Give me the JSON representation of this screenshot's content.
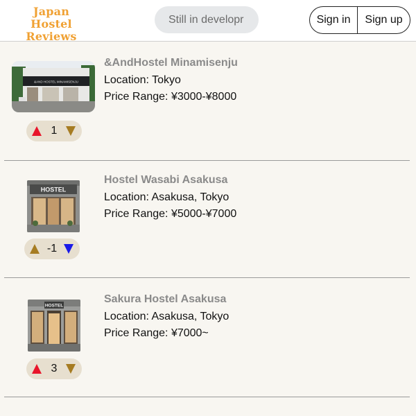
{
  "header": {
    "logo_line1": "Japan",
    "logo_line2": "Hostel Reviews",
    "search_placeholder": "Still in developr",
    "signin_label": "Sign in",
    "signup_label": "Sign up",
    "logo_color": "#f0a133"
  },
  "hostels": [
    {
      "name": "&AndHostel Minamisenju",
      "location": "Location: Tokyo",
      "price": "Price Range: ¥3000-¥8000",
      "score": "1",
      "vote_state": "up",
      "sign_text": "&AND HOSTEL MINAMISENJU"
    },
    {
      "name": "Hostel Wasabi Asakusa",
      "location": "Location: Asakusa, Tokyo",
      "price": "Price Range: ¥5000-¥7000",
      "score": "-1",
      "vote_state": "down",
      "sign_text": "HOSTEL"
    },
    {
      "name": "Sakura Hostel Asakusa",
      "location": "Location: Asakusa, Tokyo",
      "price": "Price Range: ¥7000~",
      "score": "3",
      "vote_state": "up",
      "sign_text": "HOSTEL"
    }
  ],
  "colors": {
    "upvote_active": "#e8152a",
    "downvote_active": "#1a1ae8",
    "vote_inactive": "#a67c22"
  }
}
